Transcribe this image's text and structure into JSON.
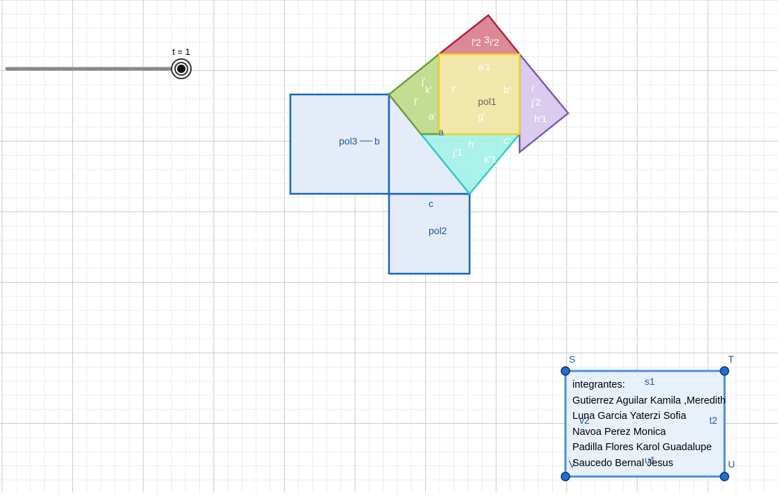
{
  "colors": {
    "grid_minor": "#ececec",
    "grid_major": "#c8c8c8",
    "blue": "#1565c0",
    "blue_fill": "#e3ecf8",
    "yellow": "#f2d21a",
    "yellow_fill": "#f1e6a6",
    "green": "#6b9f3a",
    "green_fill": "#bcd98a",
    "red": "#b0243f",
    "red_fill": "#d67c8e",
    "purple": "#7b5bb0",
    "purple_fill": "#d7c6ec",
    "cyan": "#2ecfc9",
    "cyan_fill": "#9cf0e6",
    "label_blue": "#1e5aa8"
  },
  "slider": {
    "label": "t = 1",
    "value": 1
  },
  "labels": {
    "pol1": "pol1",
    "pol2": "pol2",
    "pol3": "pol3",
    "b": "b",
    "c": "c",
    "a": "a",
    "a1": "a'1",
    "b1": "b'",
    "c1": "c'",
    "f1": "f'",
    "g1": "g'",
    "a2": "a'",
    "i1": "i'",
    "j1": "j'",
    "k1": "k'",
    "l1": "l'",
    "h1": "h'",
    "j11": "j'1",
    "k11": "k'1",
    "i2": "i'",
    "j22": "j'2",
    "h11": "h'1",
    "red_l2": "l'2",
    "red_i2": "i'2",
    "red_3": "3"
  },
  "textbox": {
    "corners": {
      "S": "S",
      "T": "T",
      "U": "U",
      "V": "V"
    },
    "edges": {
      "s1": "s1",
      "t2": "t2",
      "u1": "u1",
      "v2": "v2"
    },
    "title": "integrantes:",
    "members": [
      "Gutierrez Aguilar Kamila ,Meredith",
      "Luna Garcia Yaterzi Sofia",
      "Navoa Perez Monica",
      "Padilla Flores Karol Guadalupe",
      "Saucedo Bernal Jesus"
    ]
  }
}
